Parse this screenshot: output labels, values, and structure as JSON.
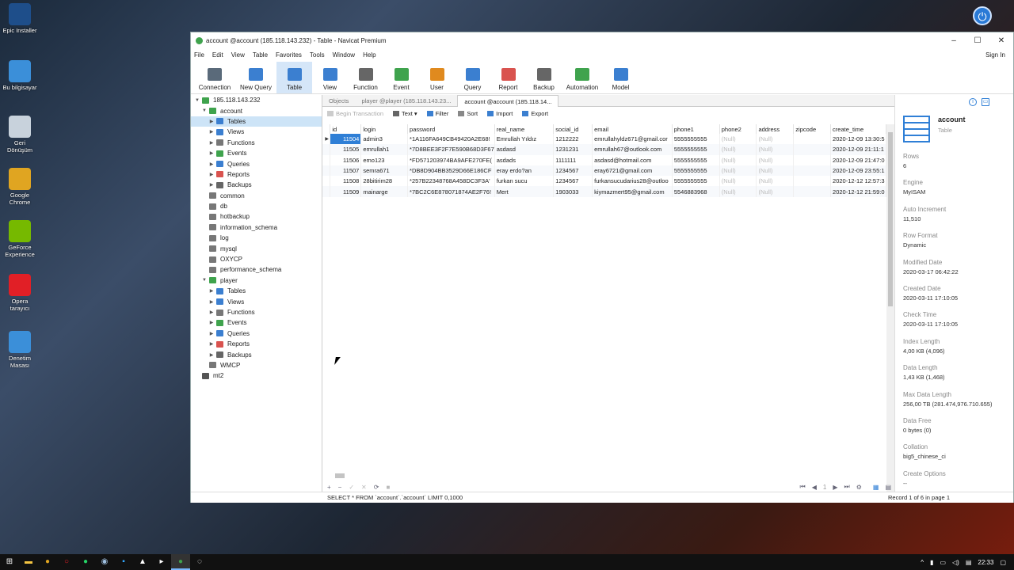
{
  "desktop": {
    "icons": [
      {
        "label": "Epic Installer",
        "color": "#1e4e8a"
      },
      {
        "label": "Bu bilgisayar",
        "color": "#3b8fd9"
      },
      {
        "label": "Geri Dönüşüm",
        "color": "#c8d2dc"
      },
      {
        "label": "Google Chrome",
        "color": "#e0a521"
      },
      {
        "label": "GeForce Experience",
        "color": "#76b900"
      },
      {
        "label": "Opera tarayıcı",
        "color": "#e11f26"
      },
      {
        "label": "Denetim Masası",
        "color": "#3b8fd9"
      }
    ]
  },
  "window": {
    "title": "account @account (185.118.143.232) - Table - Navicat Premium",
    "controls": {
      "minimize": "–",
      "maximize": "☐",
      "close": "✕"
    }
  },
  "menu": {
    "items": [
      "File",
      "Edit",
      "View",
      "Table",
      "Favorites",
      "Tools",
      "Window",
      "Help"
    ],
    "sign_in": "Sign In"
  },
  "toolbar": [
    {
      "label": "Connection",
      "color": "#5a6a7a"
    },
    {
      "label": "New Query",
      "color": "#3b7fd0"
    },
    {
      "label": "Table",
      "color": "#3b7fd0"
    },
    {
      "label": "View",
      "color": "#3b7fd0"
    },
    {
      "label": "Function",
      "color": "#666666"
    },
    {
      "label": "Event",
      "color": "#3fa34d"
    },
    {
      "label": "User",
      "color": "#e08a1e"
    },
    {
      "label": "Query",
      "color": "#3b7fd0"
    },
    {
      "label": "Report",
      "color": "#d9534f"
    },
    {
      "label": "Backup",
      "color": "#666666"
    },
    {
      "label": "Automation",
      "color": "#3fa34d"
    },
    {
      "label": "Model",
      "color": "#3b7fd0"
    }
  ],
  "sidebar": {
    "items": [
      {
        "label": "185.118.143.232",
        "indent": 0,
        "twisty": "▼",
        "color": "#3fa34d"
      },
      {
        "label": "account",
        "indent": 1,
        "twisty": "▼",
        "color": "#3fa34d"
      },
      {
        "label": "Tables",
        "indent": 2,
        "twisty": "▶",
        "color": "#3b7fd0",
        "selected": true
      },
      {
        "label": "Views",
        "indent": 2,
        "twisty": "▶",
        "color": "#3b7fd0"
      },
      {
        "label": "Functions",
        "indent": 2,
        "twisty": "▶",
        "color": "#777777"
      },
      {
        "label": "Events",
        "indent": 2,
        "twisty": "▶",
        "color": "#3fa34d"
      },
      {
        "label": "Queries",
        "indent": 2,
        "twisty": "▶",
        "color": "#3b7fd0"
      },
      {
        "label": "Reports",
        "indent": 2,
        "twisty": "▶",
        "color": "#d9534f"
      },
      {
        "label": "Backups",
        "indent": 2,
        "twisty": "▶",
        "color": "#666666"
      },
      {
        "label": "common",
        "indent": 1,
        "twisty": "",
        "color": "#777777"
      },
      {
        "label": "db",
        "indent": 1,
        "twisty": "",
        "color": "#777777"
      },
      {
        "label": "hotbackup",
        "indent": 1,
        "twisty": "",
        "color": "#777777"
      },
      {
        "label": "information_schema",
        "indent": 1,
        "twisty": "",
        "color": "#777777"
      },
      {
        "label": "log",
        "indent": 1,
        "twisty": "",
        "color": "#777777"
      },
      {
        "label": "mysql",
        "indent": 1,
        "twisty": "",
        "color": "#777777"
      },
      {
        "label": "OXYCP",
        "indent": 1,
        "twisty": "",
        "color": "#777777"
      },
      {
        "label": "performance_schema",
        "indent": 1,
        "twisty": "",
        "color": "#777777"
      },
      {
        "label": "player",
        "indent": 1,
        "twisty": "▼",
        "color": "#3fa34d"
      },
      {
        "label": "Tables",
        "indent": 2,
        "twisty": "▶",
        "color": "#3b7fd0"
      },
      {
        "label": "Views",
        "indent": 2,
        "twisty": "▶",
        "color": "#3b7fd0"
      },
      {
        "label": "Functions",
        "indent": 2,
        "twisty": "▶",
        "color": "#777777"
      },
      {
        "label": "Events",
        "indent": 2,
        "twisty": "▶",
        "color": "#3fa34d"
      },
      {
        "label": "Queries",
        "indent": 2,
        "twisty": "▶",
        "color": "#3b7fd0"
      },
      {
        "label": "Reports",
        "indent": 2,
        "twisty": "▶",
        "color": "#d9534f"
      },
      {
        "label": "Backups",
        "indent": 2,
        "twisty": "▶",
        "color": "#666666"
      },
      {
        "label": "WMCP",
        "indent": 1,
        "twisty": "",
        "color": "#777777"
      },
      {
        "label": "mt2",
        "indent": 0,
        "twisty": "",
        "color": "#555555"
      }
    ]
  },
  "tabs": [
    {
      "label": "Objects",
      "active": false
    },
    {
      "label": "player @player (185.118.143.23...",
      "active": false
    },
    {
      "label": "account @account (185.118.14...",
      "active": true
    }
  ],
  "subtoolbar": {
    "begin_transaction": "Begin Transaction",
    "text": "Text",
    "filter": "Filter",
    "sort": "Sort",
    "import": "Import",
    "export": "Export"
  },
  "table": {
    "columns": [
      "id",
      "login",
      "password",
      "real_name",
      "social_id",
      "email",
      "phone1",
      "phone2",
      "address",
      "zipcode",
      "create_time"
    ],
    "rows": [
      [
        "11504",
        "admin3",
        "*1A116FA649CB49420A2E68!",
        "Emrullah Yıldız",
        "1212222",
        "emrullahyldz671@gmail.cor",
        "5555555555",
        "(Null)",
        "(Null)",
        "",
        "2020-12-09 13:30:5"
      ],
      [
        "11505",
        "emrullah1",
        "*7D8BEE3F2F7E590B68D3F67",
        "asdasd",
        "1231231",
        "emrullah67@outlook.com",
        "5555555555",
        "(Null)",
        "(Null)",
        "",
        "2020-12-09 21:11:1"
      ],
      [
        "11506",
        "emo123",
        "*FD571203974BA9AFE270FE(",
        "asdads",
        "1111111",
        "asdasd@hotmail.com",
        "5555555555",
        "(Null)",
        "(Null)",
        "",
        "2020-12-09 21:47:0"
      ],
      [
        "11507",
        "semra671",
        "*DB8D904BB3529D66E186CF",
        "eray erdo?an",
        "1234567",
        "eray6721@gmail.com",
        "5555555555",
        "(Null)",
        "(Null)",
        "",
        "2020-12-09 23:55:1"
      ],
      [
        "11508",
        "28bitirim28",
        "*257B22348768A458DC3F3A'",
        "furkan sucu",
        "1234567",
        "furkansucudarius28@outloo",
        "5555555555",
        "(Null)",
        "(Null)",
        "",
        "2020-12-12 12:57:3"
      ],
      [
        "11509",
        "mainarge",
        "*7BC2C6E878071874AE2F76!",
        "Mert",
        "1903033",
        "kiymazmert95@gmail.com",
        "5546883968",
        "(Null)",
        "(Null)",
        "",
        "2020-12-12 21:59:0"
      ]
    ]
  },
  "grid_footer": {
    "page": "1"
  },
  "info": {
    "name": "account",
    "type": "Table",
    "props": [
      {
        "key": "Rows",
        "value": "6"
      },
      {
        "key": "Engine",
        "value": "MyISAM"
      },
      {
        "key": "Auto Increment",
        "value": "11,510"
      },
      {
        "key": "Row Format",
        "value": "Dynamic"
      },
      {
        "key": "Modified Date",
        "value": "2020-03-17 06:42:22"
      },
      {
        "key": "Created Date",
        "value": "2020-03-11 17:10:05"
      },
      {
        "key": "Check Time",
        "value": "2020-03-11 17:10:05"
      },
      {
        "key": "Index Length",
        "value": "4,00 KB (4,096)"
      },
      {
        "key": "Data Length",
        "value": "1,43 KB (1,468)"
      },
      {
        "key": "Max Data Length",
        "value": "256,00 TB (281.474,976.710.655)"
      },
      {
        "key": "Data Free",
        "value": "0 bytes (0)"
      },
      {
        "key": "Collation",
        "value": "big5_chinese_ci"
      },
      {
        "key": "Create Options",
        "value": "--"
      }
    ]
  },
  "status": {
    "sql": "SELECT * FROM `account`.`account` LIMIT 0,1000",
    "record": "Record 1 of 6 in page 1"
  },
  "taskbar": {
    "time": "22:33"
  }
}
